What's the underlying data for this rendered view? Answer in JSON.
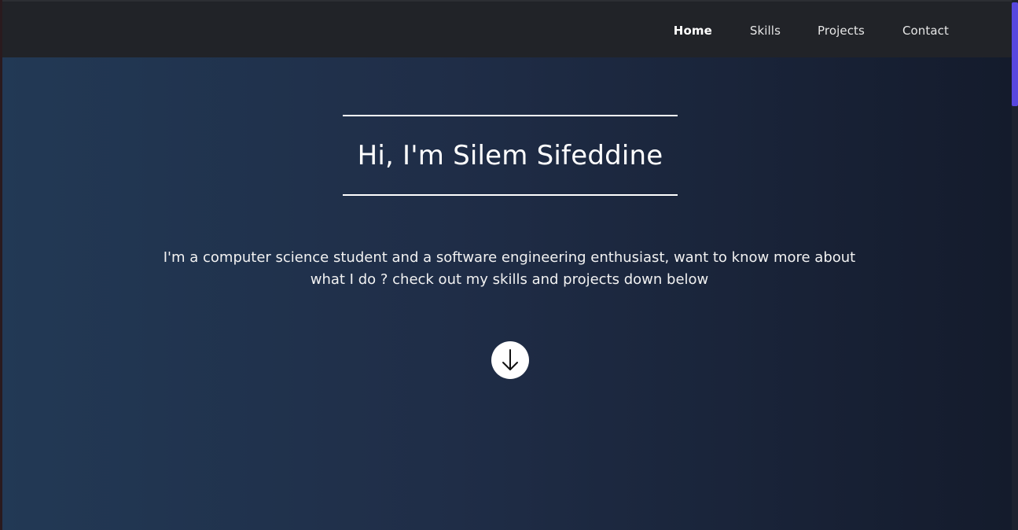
{
  "nav": {
    "items": [
      {
        "label": "Home"
      },
      {
        "label": "Skills"
      },
      {
        "label": "Projects"
      },
      {
        "label": "Contact"
      }
    ]
  },
  "hero": {
    "title": "Hi, I'm Silem Sifeddine",
    "intro": "I'm a computer science student and a software engineering enthusiast, want to know more about what I do ? check out my skills and projects down below",
    "scroll_icon": "arrow-down-icon"
  },
  "colors": {
    "navbar": "#212328",
    "hero_gradient_start": "#223955",
    "hero_gradient_end": "#141b2c",
    "scrollbar_thumb": "#5847df"
  }
}
